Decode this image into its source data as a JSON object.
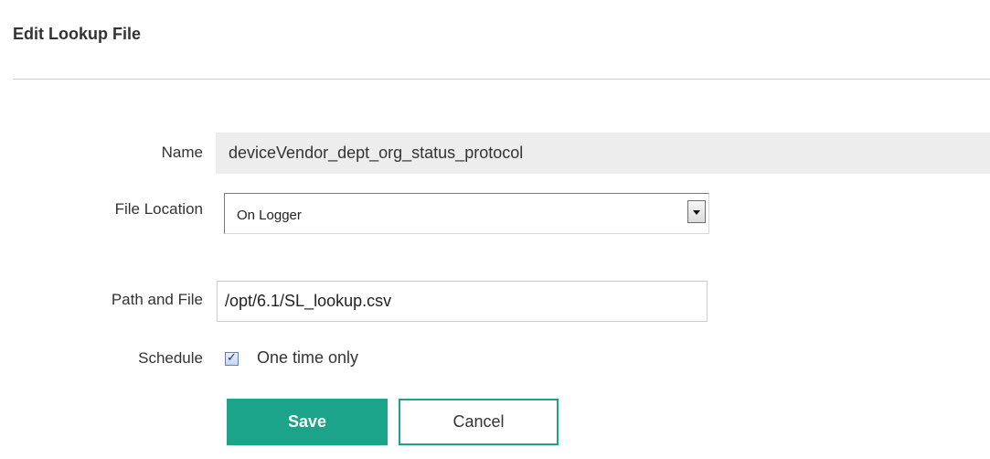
{
  "header": {
    "title": "Edit Lookup File"
  },
  "form": {
    "name": {
      "label": "Name",
      "value": "deviceVendor_dept_org_status_protocol"
    },
    "file_location": {
      "label": "File Location",
      "selected": "On Logger"
    },
    "path_and_file": {
      "label": "Path and File",
      "value": "/opt/6.1/SL_lookup.csv"
    },
    "schedule": {
      "label": "Schedule",
      "checkbox_label": "One time only",
      "checked": true
    }
  },
  "actions": {
    "save_label": "Save",
    "cancel_label": "Cancel"
  },
  "colors": {
    "accent": "#1ba48a",
    "readonly_field_bg": "#ededed",
    "divider": "#cccccc"
  },
  "icons": {
    "dropdown": "chevron-down-icon",
    "checkbox": "checkmark-icon"
  }
}
